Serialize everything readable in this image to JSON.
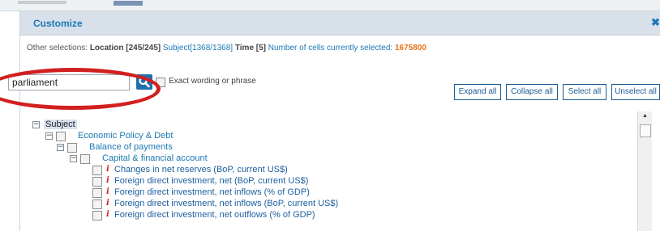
{
  "dialog": {
    "title": "Customize",
    "close_symbol": "✖"
  },
  "selections": {
    "label": "Other selections:",
    "location": "Location [245/245]",
    "subject": "Subject[1368/1368]",
    "time": "Time [5]",
    "cells_label": "Number of cells currently selected:",
    "cells_count": "1675800"
  },
  "search": {
    "value": "parliament",
    "exact_label": "Exact wording or phrase"
  },
  "toolbar": {
    "expand_all": "Expand all",
    "collapse_all": "Collapse all",
    "select_all": "Select all",
    "unselect_all": "Unselect all"
  },
  "tree": {
    "root": "Subject",
    "level1": "Economic Policy & Debt",
    "level2": "Balance of payments",
    "level3": "Capital & financial account",
    "items": [
      "Changes in net reserves (BoP, current US$)",
      "Foreign direct investment, net (BoP, current US$)",
      "Foreign direct investment, net inflows (% of GDP)",
      "Foreign direct investment, net inflows (BoP, current US$)",
      "Foreign direct investment, net outflows (% of GDP)"
    ],
    "expander_symbol": "−",
    "info_symbol": "i"
  },
  "colors": {
    "accent": "#1c78b6",
    "count": "#e4741b",
    "annotation": "#d21f1f",
    "info": "#cc2222"
  }
}
